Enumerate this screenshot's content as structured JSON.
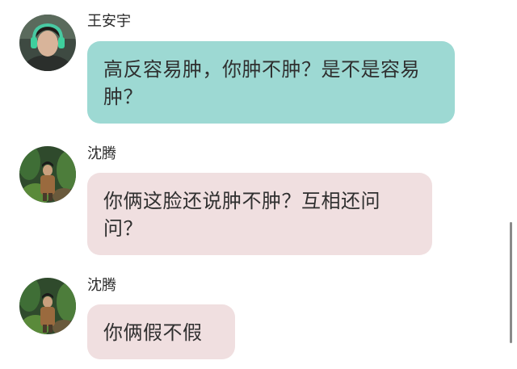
{
  "messages": [
    {
      "sender": "王安宇",
      "avatar": "male-portrait-green-headphones",
      "bubble_color": "#9dd9d3",
      "text": "高反容易肿，你肿不肿？是不是容易肿？"
    },
    {
      "sender": "沈腾",
      "avatar": "male-portrait-jungle-foliage",
      "bubble_color": "#f0dfe0",
      "text": "你俩这脸还说肿不肿？互相还问问？"
    },
    {
      "sender": "沈腾",
      "avatar": "male-portrait-jungle-foliage",
      "bubble_color": "#f0dfe0",
      "text": "你俩假不假"
    }
  ]
}
